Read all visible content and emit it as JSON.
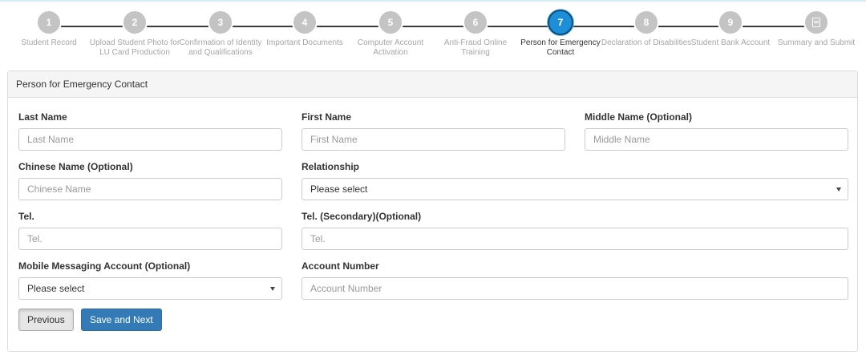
{
  "steps": [
    {
      "num": "1",
      "label": "Student Record"
    },
    {
      "num": "2",
      "label": "Upload Student Photo for LU Card Production"
    },
    {
      "num": "3",
      "label": "Confirmation of Identity and Qualifications"
    },
    {
      "num": "4",
      "label": "Important Documents"
    },
    {
      "num": "5",
      "label": "Computer Account Activation"
    },
    {
      "num": "6",
      "label": "Anti-Fraud Online Training"
    },
    {
      "num": "7",
      "label": "Person for Emergency Contact",
      "active": true
    },
    {
      "num": "8",
      "label": "Declaration of Disabilities"
    },
    {
      "num": "9",
      "label": "Student Bank Account"
    },
    {
      "num": "",
      "label": "Summary and Submit",
      "icon": "document-list-icon"
    }
  ],
  "panel": {
    "title": "Person for Emergency Contact"
  },
  "form": {
    "last_name": {
      "label": "Last Name",
      "placeholder": "Last Name"
    },
    "first_name": {
      "label": "First Name",
      "placeholder": "First Name"
    },
    "middle_name": {
      "label": "Middle Name (Optional)",
      "placeholder": "Middle Name"
    },
    "chinese_name": {
      "label": "Chinese Name (Optional)",
      "placeholder": "Chinese Name"
    },
    "relationship": {
      "label": "Relationship",
      "selected": "Please select"
    },
    "tel": {
      "label": "Tel.",
      "placeholder": "Tel."
    },
    "tel_secondary": {
      "label": "Tel. (Secondary)(Optional)",
      "placeholder": "Tel."
    },
    "messaging": {
      "label": "Mobile Messaging Account (Optional)",
      "selected": "Please select"
    },
    "account_number": {
      "label": "Account Number",
      "placeholder": "Account Number"
    }
  },
  "buttons": {
    "previous": "Previous",
    "save_next": "Save and Next"
  },
  "colors": {
    "active_step": "#1e8ed8",
    "inactive_step": "#c4c4c4",
    "primary_button": "#337ab7"
  }
}
